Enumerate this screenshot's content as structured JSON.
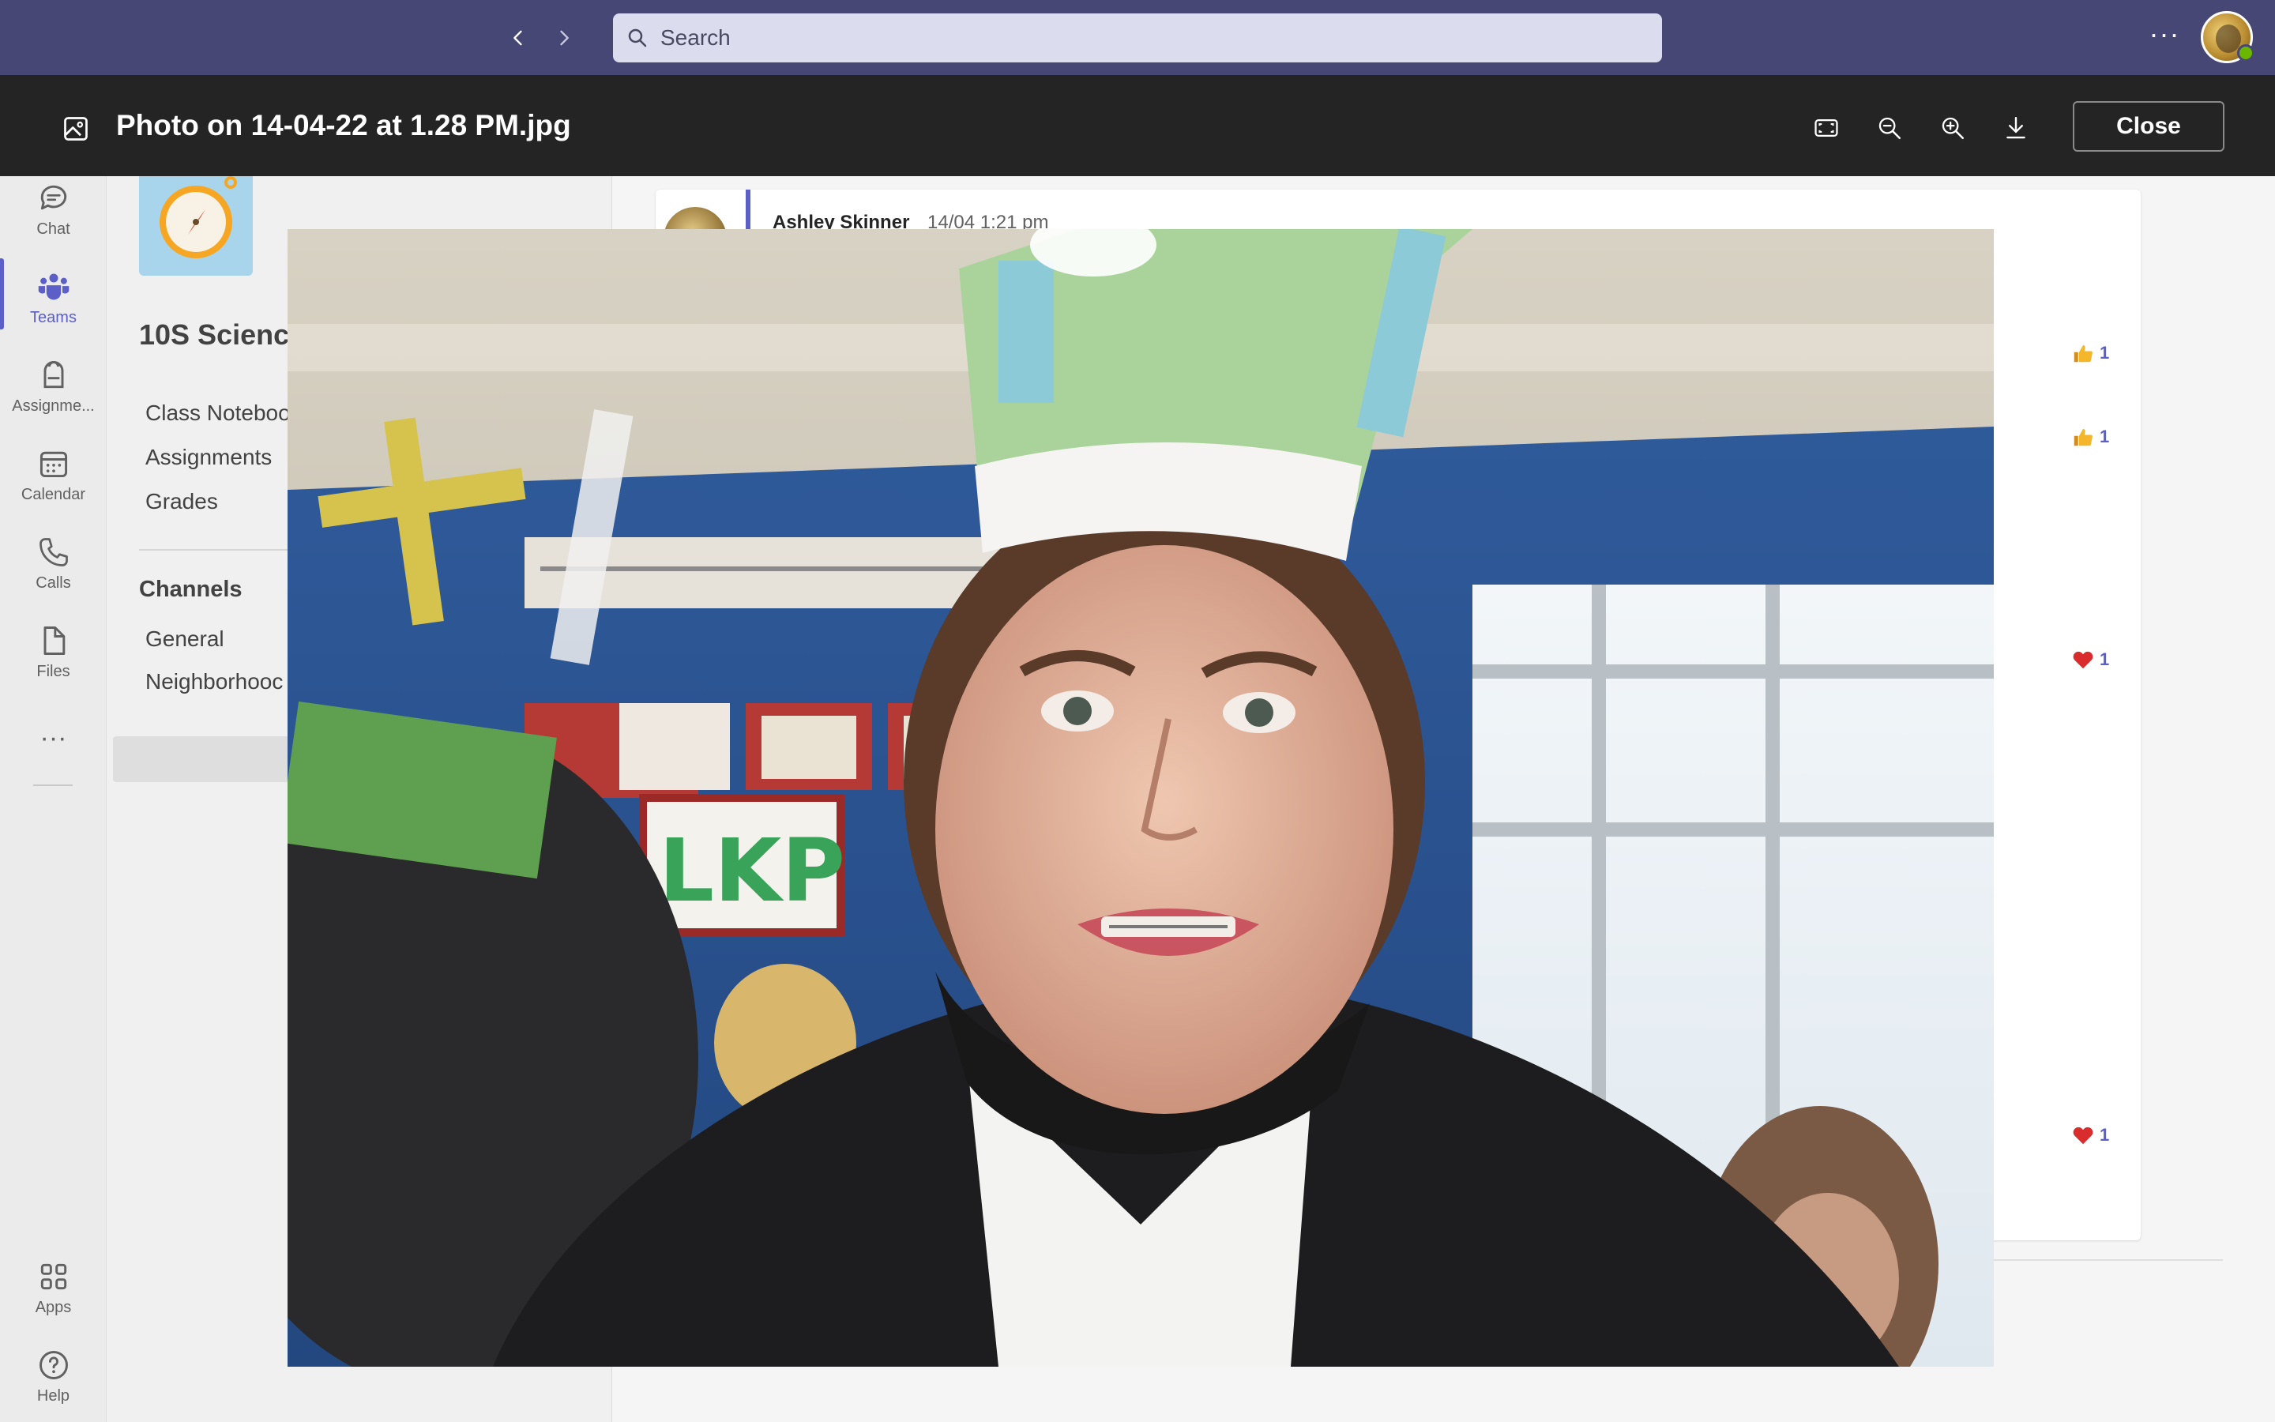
{
  "topbar": {
    "search_placeholder": "Search",
    "back_icon": "chevron-left-icon",
    "forward_icon": "chevron-right-icon",
    "more_label": "···",
    "brand_color": "#464775"
  },
  "rail": {
    "items": [
      {
        "label": "Chat",
        "icon": "chat-icon"
      },
      {
        "label": "Teams",
        "icon": "teams-icon",
        "active": true
      },
      {
        "label": "Assignme...",
        "icon": "assignments-icon"
      },
      {
        "label": "Calendar",
        "icon": "calendar-icon"
      },
      {
        "label": "Calls",
        "icon": "phone-icon"
      },
      {
        "label": "Files",
        "icon": "file-icon"
      }
    ],
    "more_label": "···",
    "bottom": [
      {
        "label": "Apps",
        "icon": "apps-icon"
      },
      {
        "label": "Help",
        "icon": "help-icon"
      }
    ],
    "accent": "#5b5fc7"
  },
  "team_panel": {
    "team_name": "10S Scienc",
    "links": [
      "Class Noteboo",
      "Assignments",
      "Grades"
    ],
    "channels_header": "Channels",
    "channels": [
      "General",
      "Neighborhooc"
    ]
  },
  "post": {
    "author": "Ashley Skinner",
    "time": "14/04 1:21 pm",
    "reactions": [
      {
        "type": "like",
        "count": "1"
      },
      {
        "type": "like",
        "count": "1"
      },
      {
        "type": "heart",
        "count": "1"
      },
      {
        "type": "heart",
        "count": "1"
      }
    ]
  },
  "viewer": {
    "title": "Photo on 14-04-22 at 1.28 PM.jpg",
    "close_label": "Close",
    "tools": [
      "fit-screen-icon",
      "zoom-out-icon",
      "zoom-in-icon",
      "download-icon"
    ]
  }
}
